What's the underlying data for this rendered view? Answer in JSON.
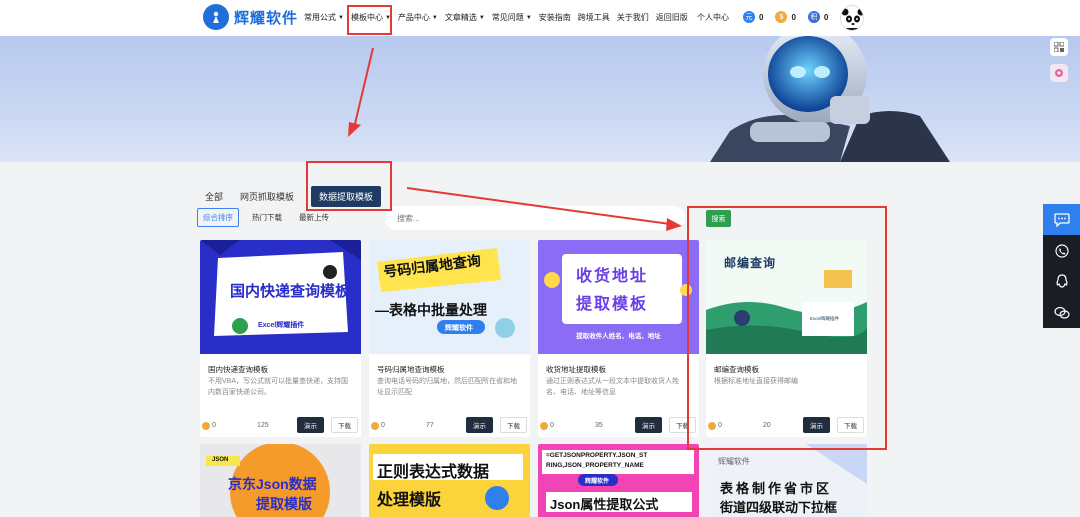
{
  "header": {
    "logo_mark": "",
    "logo_text": "辉耀软件",
    "nav": [
      {
        "label": "常用公式",
        "caret": true
      },
      {
        "label": "模板中心",
        "caret": true
      },
      {
        "label": "产品中心",
        "caret": true
      },
      {
        "label": "文章精选",
        "caret": true
      },
      {
        "label": "常见问题",
        "caret": true
      },
      {
        "label": "安装指南",
        "caret": false
      },
      {
        "label": "跨境工具",
        "caret": false
      },
      {
        "label": "关于我们",
        "caret": false
      },
      {
        "label": "返回旧版",
        "caret": false
      }
    ],
    "personal_center": "个人中心",
    "badge_1": "元",
    "badge_1_count": "0",
    "badge_2_count": "0",
    "badge_3": "积",
    "badge_3_count": "0"
  },
  "tabs": {
    "all": "全部",
    "web_scrape": "网页抓取模板",
    "data_extract": "数据提取模板"
  },
  "sorts": {
    "combined": "综合排序",
    "hot": "热门下载",
    "latest": "最新上传"
  },
  "search": {
    "placeholder": "搜索...",
    "button": "搜索"
  },
  "cards": [
    {
      "title": "国内快递查询模板",
      "desc": "不用VBA，写公式就可以批量查快递，支持国内数百家快递公司。",
      "coins": "0",
      "downloads": "125",
      "demo": "演示",
      "download": "下载",
      "img_line1": "国内快递查询模板",
      "img_line2": "Excel辉耀插件"
    },
    {
      "title": "号码归属地查询模板",
      "desc": "查询电话号码的归属地，然后匹配所在省和地址显示匹配",
      "coins": "0",
      "downloads": "77",
      "demo": "演示",
      "download": "下载",
      "img_line1": "号码归属地查询",
      "img_line2": "—表格中批量处理",
      "img_line3": "辉耀软件"
    },
    {
      "title": "收货地址提取模板",
      "desc": "通过正则表达式从一段文本中提取收货人姓名、电话、地址等信息",
      "coins": "0",
      "downloads": "35",
      "demo": "演示",
      "download": "下载",
      "img_line1": "收货地址",
      "img_line2": "提取模板",
      "img_line3": "提取收件人姓名、电话、地址"
    },
    {
      "title": "邮编查询模板",
      "desc": "根据标准地址直接获得邮编",
      "coins": "0",
      "downloads": "20",
      "demo": "演示",
      "download": "下载",
      "img_line1": "邮编查询",
      "img_line2": "Excel辉耀插件"
    }
  ],
  "row2": [
    {
      "line1": "京东Json数据",
      "line2": "提取模版",
      "tag": "JSON"
    },
    {
      "line1": "正则表达式数据",
      "line2": "处理模版"
    },
    {
      "line1": "=GETJSONPROPERTY.JSON_ST",
      "line2": "RING,JSON_PROPERTY_NAME",
      "line3": "辉耀软件",
      "line4": "Json属性提取公式"
    },
    {
      "line1": "辉耀软件",
      "line2": "表格制作省市区",
      "line3": "街道四级联动下拉框"
    }
  ],
  "colors": {
    "brand_blue": "#1e6fd9",
    "nav_active_tab": "#1f3b63",
    "search_green": "#2e9e4f",
    "highlight_red": "#e53935",
    "side_panel": "#1a1d24"
  }
}
